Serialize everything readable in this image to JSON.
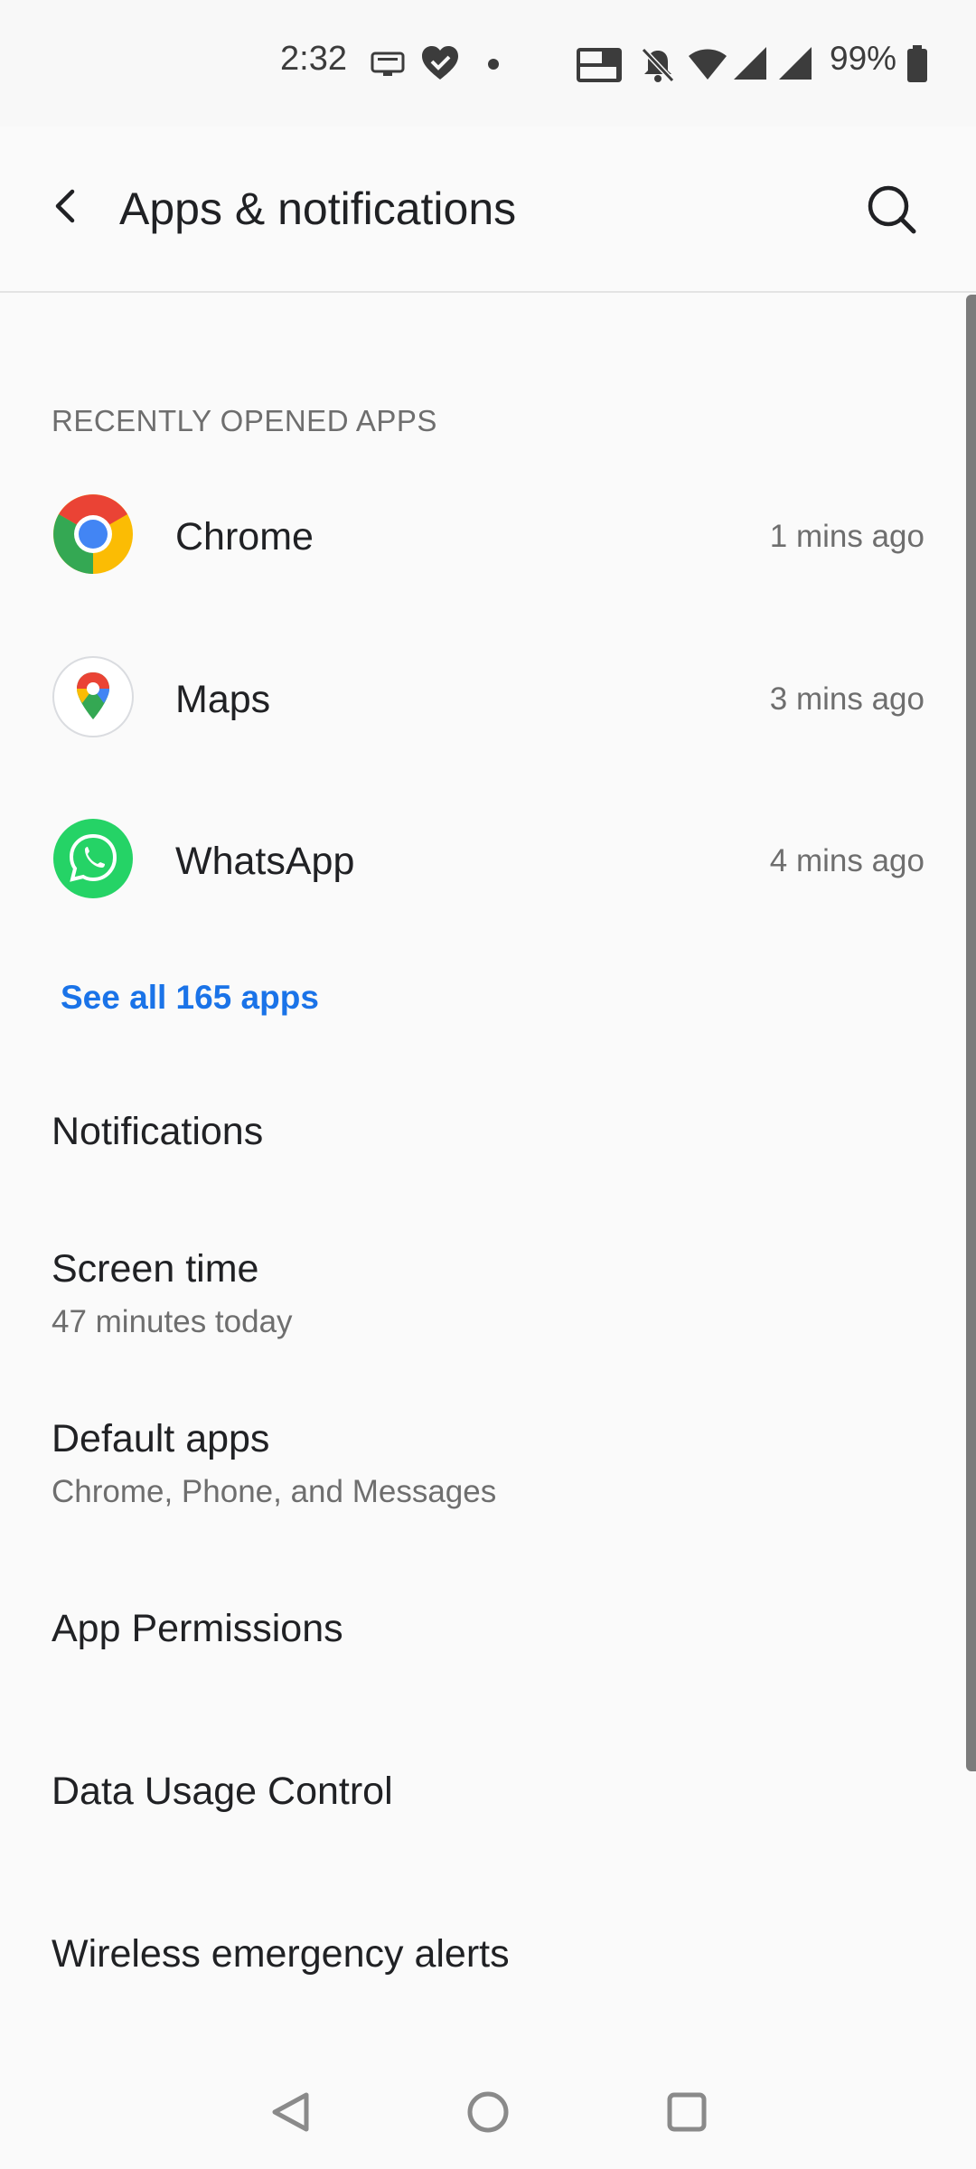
{
  "status_bar": {
    "time": "2:32",
    "battery": "99%",
    "icons": [
      "screen-share-icon",
      "heart-check-icon",
      "dot-icon",
      "volte-lte-icon",
      "bell-off-icon",
      "wifi-icon",
      "signal-icon",
      "signal-icon",
      "battery-icon"
    ]
  },
  "app_bar": {
    "title": "Apps & notifications"
  },
  "recent": {
    "header": "RECENTLY OPENED APPS",
    "apps": [
      {
        "name": "Chrome",
        "time": "1 mins ago",
        "icon": "chrome-icon"
      },
      {
        "name": "Maps",
        "time": "3 mins ago",
        "icon": "maps-icon"
      },
      {
        "name": "WhatsApp",
        "time": "4 mins ago",
        "icon": "whatsapp-icon"
      }
    ],
    "see_all": "See all 165 apps"
  },
  "settings": [
    {
      "title": "Notifications",
      "subtitle": ""
    },
    {
      "title": "Screen time",
      "subtitle": "47 minutes today"
    },
    {
      "title": "Default apps",
      "subtitle": "Chrome, Phone, and Messages"
    },
    {
      "title": "App Permissions",
      "subtitle": ""
    },
    {
      "title": "Data Usage Control",
      "subtitle": ""
    },
    {
      "title": "Wireless emergency alerts",
      "subtitle": ""
    }
  ],
  "nav": [
    "back-icon",
    "home-icon",
    "recents-icon"
  ],
  "colors": {
    "accent": "#1a73e8",
    "text": "#202124",
    "secondary": "#6e6e6e",
    "background": "#fafafa"
  }
}
